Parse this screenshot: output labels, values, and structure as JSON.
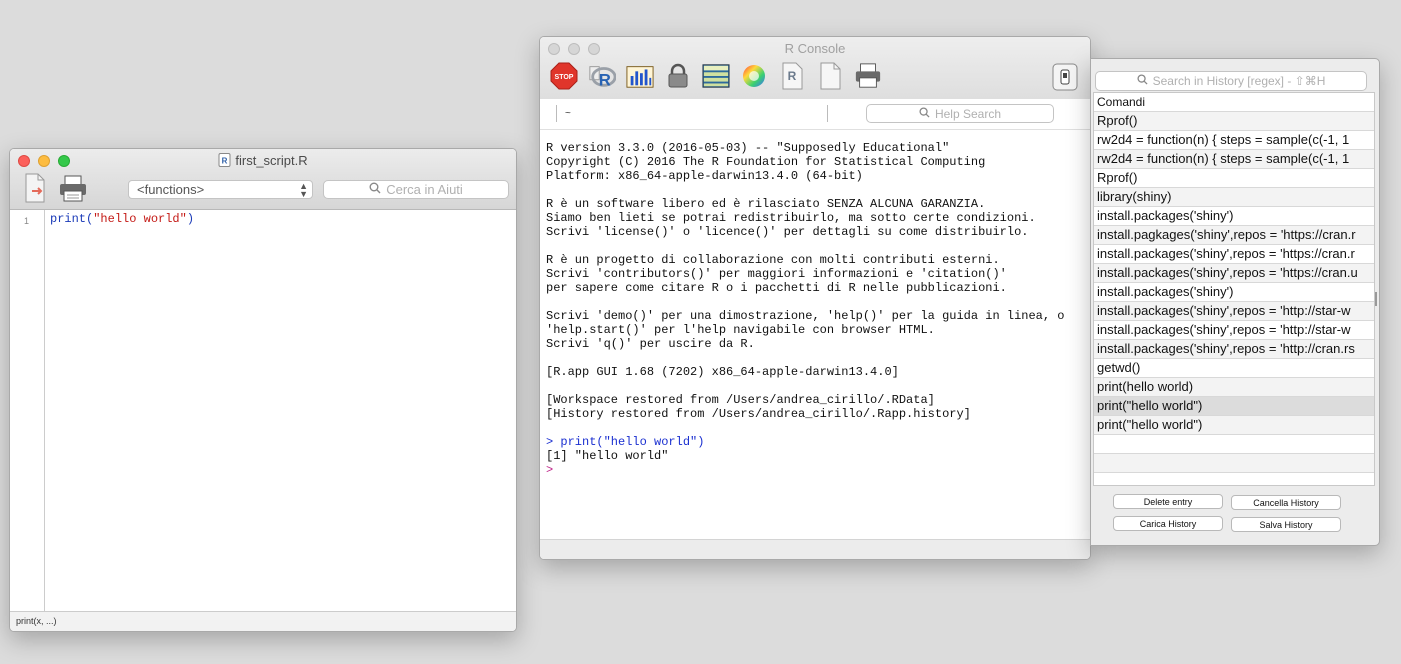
{
  "script_window": {
    "title": "first_script.R",
    "functions_select": "<functions>",
    "search_placeholder": "Cerca in Aiuti",
    "line_number": "1",
    "code": {
      "prefix": "print(",
      "string": "\"hello world\"",
      "suffix": ")"
    },
    "status": "print(x, ...)"
  },
  "console_window": {
    "title": "R Console",
    "path": "~",
    "search_placeholder": "Help Search",
    "toolbar_icons": [
      "stop-icon",
      "r-source-icon",
      "chart-icon",
      "lock-icon",
      "grid-icon",
      "color-wheel-icon",
      "r-document-icon",
      "blank-document-icon",
      "print-icon"
    ],
    "output_lines": [
      "R version 3.3.0 (2016-05-03) -- \"Supposedly Educational\"",
      "Copyright (C) 2016 The R Foundation for Statistical Computing",
      "Platform: x86_64-apple-darwin13.4.0 (64-bit)",
      "",
      "R è un software libero ed è rilasciato SENZA ALCUNA GARANZIA.",
      "Siamo ben lieti se potrai redistribuirlo, ma sotto certe condizioni.",
      "Scrivi 'license()' o 'licence()' per dettagli su come distribuirlo.",
      "",
      "R è un progetto di collaborazione con molti contributi esterni.",
      "Scrivi 'contributors()' per maggiori informazioni e 'citation()'",
      "per sapere come citare R o i pacchetti di R nelle pubblicazioni.",
      "",
      "Scrivi 'demo()' per una dimostrazione, 'help()' per la guida in linea, o",
      "'help.start()' per l'help navigabile con browser HTML.",
      "Scrivi 'q()' per uscire da R.",
      "",
      "[R.app GUI 1.68 (7202) x86_64-apple-darwin13.4.0]",
      "",
      "[Workspace restored from /Users/andrea_cirillo/.RData]",
      "[History restored from /Users/andrea_cirillo/.Rapp.history]",
      ""
    ],
    "command_line": "> print(\"hello world\")",
    "result_line": "[1] \"hello world\"",
    "prompt": ">"
  },
  "history_window": {
    "search_placeholder": "Search in History [regex] - ⇧⌘H",
    "column_header": "Comandi",
    "entries": [
      "Rprof()",
      "rw2d4 = function(n) { steps = sample(c(-1, 1",
      "rw2d4 = function(n) { steps = sample(c(-1, 1",
      "Rprof()",
      "library(shiny)",
      "install.packages('shiny')",
      "install.pagkages('shiny',repos = 'https://cran.r",
      "install.packages('shiny',repos = 'https://cran.r",
      "install.packages('shiny',repos = 'https://cran.u",
      "install.packages('shiny')",
      "install.packages('shiny',repos = 'http://star-w",
      "install.packages('shiny',repos = 'http://star-w",
      "install.packages('shiny',repos = 'http://cran.rs",
      "getwd()",
      "print(hello world)",
      "print(\"hello world\")",
      "print(\"hello world\")",
      "",
      ""
    ],
    "buttons": {
      "delete": "Delete entry",
      "clear": "Cancella History",
      "load": "Carica History",
      "save": "Salva History"
    }
  }
}
